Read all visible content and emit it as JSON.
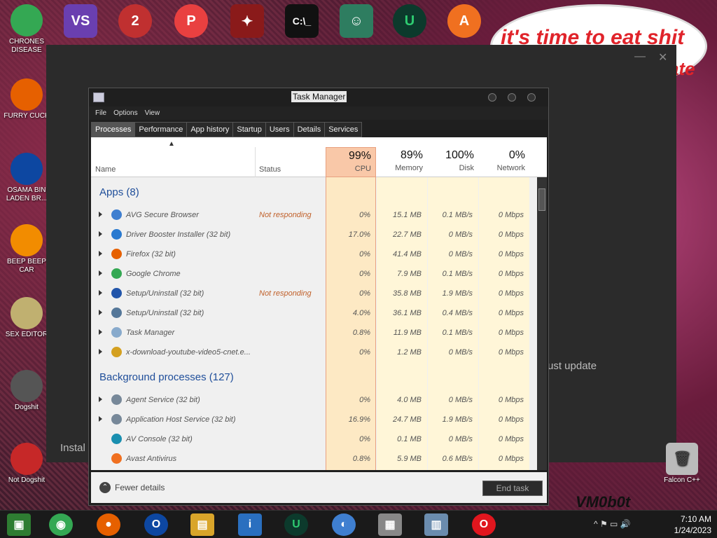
{
  "desktop": {
    "left_icons": [
      {
        "label": "CHRONES DISEASE",
        "icon": "chrome-icon",
        "color": "#34a853"
      },
      {
        "label": "FURRY CUCK",
        "icon": "firefox-icon",
        "color": "#e66000"
      },
      {
        "label": "OSAMA BIN LADEN BR...",
        "icon": "obama-logo-icon",
        "color": "#0d47a1"
      },
      {
        "label": "BEEP BEEP CAR",
        "icon": "vlc-icon",
        "color": "#f28c00"
      },
      {
        "label": "SEX EDITOR",
        "icon": "hxd-icon",
        "color": "#c0b070"
      },
      {
        "label": "Dogshit",
        "icon": "ball-icon",
        "color": "#555"
      },
      {
        "label": "Not Dogshit",
        "icon": "devcpp-icon",
        "color": "#c62828"
      }
    ],
    "right_icon": {
      "label": "Falcon C++",
      "icon": "recycle-bin-icon"
    },
    "bubble_text": "it's time to eat shit",
    "bubble_text2": "ate",
    "watermark": "VM0b0t"
  },
  "installer": {
    "update_text": "ust update",
    "install_text": "Instal"
  },
  "task_manager": {
    "title": "Task Manager",
    "menu": [
      "File",
      "Options",
      "View"
    ],
    "tabs": [
      "Processes",
      "Performance",
      "App history",
      "Startup",
      "Users",
      "Details",
      "Services"
    ],
    "active_tab": "Processes",
    "columns": {
      "name": "Name",
      "status": "Status",
      "cpu": {
        "pct": "99%",
        "label": "CPU"
      },
      "memory": {
        "pct": "89%",
        "label": "Memory"
      },
      "disk": {
        "pct": "100%",
        "label": "Disk"
      },
      "network": {
        "pct": "0%",
        "label": "Network"
      }
    },
    "apps_header": "Apps (8)",
    "apps": [
      {
        "name": "AVG Secure Browser",
        "status": "Not responding",
        "cpu": "0%",
        "mem": "15.1 MB",
        "disk": "0.1 MB/s",
        "net": "0 Mbps",
        "icon": "avg-browser-icon",
        "icolor": "#3f7fd0"
      },
      {
        "name": "Driver Booster Installer (32 bit)",
        "status": "",
        "cpu": "17.0%",
        "mem": "22.7 MB",
        "disk": "0 MB/s",
        "net": "0 Mbps",
        "icon": "driver-booster-icon",
        "icolor": "#2a7ad0"
      },
      {
        "name": "Firefox (32 bit)",
        "status": "",
        "cpu": "0%",
        "mem": "41.4 MB",
        "disk": "0 MB/s",
        "net": "0 Mbps",
        "icon": "firefox-icon",
        "icolor": "#e66000"
      },
      {
        "name": "Google Chrome",
        "status": "",
        "cpu": "0%",
        "mem": "7.9 MB",
        "disk": "0.1 MB/s",
        "net": "0 Mbps",
        "icon": "chrome-icon",
        "icolor": "#34a853"
      },
      {
        "name": "Setup/Uninstall (32 bit)",
        "status": "Not responding",
        "cpu": "0%",
        "mem": "35.8 MB",
        "disk": "1.9 MB/s",
        "net": "0 Mbps",
        "icon": "setup-icon",
        "icolor": "#2255aa"
      },
      {
        "name": "Setup/Uninstall (32 bit)",
        "status": "",
        "cpu": "4.0%",
        "mem": "36.1 MB",
        "disk": "0.4 MB/s",
        "net": "0 Mbps",
        "icon": "setup-icon",
        "icolor": "#557799"
      },
      {
        "name": "Task Manager",
        "status": "",
        "cpu": "0.8%",
        "mem": "11.9 MB",
        "disk": "0.1 MB/s",
        "net": "0 Mbps",
        "icon": "task-manager-icon",
        "icolor": "#88aacc"
      },
      {
        "name": "x-download-youtube-video5-cnet.e...",
        "status": "",
        "cpu": "0%",
        "mem": "1.2 MB",
        "disk": "0 MB/s",
        "net": "0 Mbps",
        "icon": "installer-icon",
        "icolor": "#d4a020"
      }
    ],
    "bg_header": "Background processes (127)",
    "background": [
      {
        "name": "Agent Service (32 bit)",
        "cpu": "0%",
        "mem": "4.0 MB",
        "disk": "0 MB/s",
        "net": "0 Mbps",
        "icon": "service-icon",
        "icolor": "#778899",
        "expand": true
      },
      {
        "name": "Application Host Service (32 bit)",
        "cpu": "16.9%",
        "mem": "24.7 MB",
        "disk": "1.9 MB/s",
        "net": "0 Mbps",
        "icon": "service-icon",
        "icolor": "#778899",
        "expand": true
      },
      {
        "name": "AV Console (32 bit)",
        "cpu": "0%",
        "mem": "0.1 MB",
        "disk": "0 MB/s",
        "net": "0 Mbps",
        "icon": "av-console-icon",
        "icolor": "#1a8fb0",
        "expand": false
      },
      {
        "name": "Avast Antivirus",
        "cpu": "0.8%",
        "mem": "5.9 MB",
        "disk": "0.6 MB/s",
        "net": "0 Mbps",
        "icon": "avast-icon",
        "icolor": "#f07020",
        "expand": false
      }
    ],
    "fewer_details": "Fewer details",
    "end_task": "End task"
  },
  "taskbar": {
    "clock_time": "7:10 AM",
    "clock_date": "1/24/2023"
  }
}
